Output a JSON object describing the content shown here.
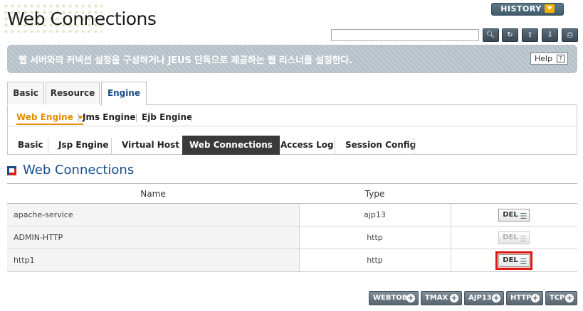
{
  "header": {
    "title": "Web Connections",
    "history_label": "HISTORY",
    "search_placeholder": "",
    "tools": [
      "search-icon",
      "refresh-icon",
      "xml-export-icon",
      "xml-import-icon",
      "print-icon"
    ]
  },
  "banner": {
    "description": "웹 서버와의 커넥션 설정을 구성하거나 JEUS 단독으로 제공하는 웹 리스너를 설정한다.",
    "help_label": "Help",
    "help_icon_glyph": "?"
  },
  "primary_tabs": [
    {
      "label": "Basic",
      "active": false
    },
    {
      "label": "Resource",
      "active": false
    },
    {
      "label": "Engine",
      "active": true
    }
  ],
  "engine_tabs": [
    {
      "label": "Web Engine",
      "active": true
    },
    {
      "label": "Jms Engine",
      "active": false
    },
    {
      "label": "Ejb Engine",
      "active": false
    }
  ],
  "web_engine_tabs": [
    {
      "label": "Basic",
      "active": false
    },
    {
      "label": "Jsp Engine",
      "active": false
    },
    {
      "label": "Virtual Host",
      "active": false
    },
    {
      "label": "Web Connections",
      "active": true
    },
    {
      "label": "Access Log",
      "active": false
    },
    {
      "label": "Session Config",
      "active": false
    }
  ],
  "section": {
    "title": "Web Connections"
  },
  "table": {
    "columns": [
      "Name",
      "Type",
      ""
    ],
    "rows": [
      {
        "name": "apache-service",
        "type": "ajp13",
        "del_label": "DEL",
        "del_enabled": true,
        "highlighted": false
      },
      {
        "name": "ADMIN-HTTP",
        "type": "http",
        "del_label": "DEL",
        "del_enabled": false,
        "highlighted": false
      },
      {
        "name": "http1",
        "type": "http",
        "del_label": "DEL",
        "del_enabled": true,
        "highlighted": true
      }
    ]
  },
  "add_buttons": [
    "WEBTOB",
    "TMAX",
    "AJP13",
    "HTTP",
    "TCP"
  ],
  "colors": {
    "accent": "#e38d00",
    "title_blue": "#1a4d8c",
    "highlight_red": "#e0140f"
  }
}
